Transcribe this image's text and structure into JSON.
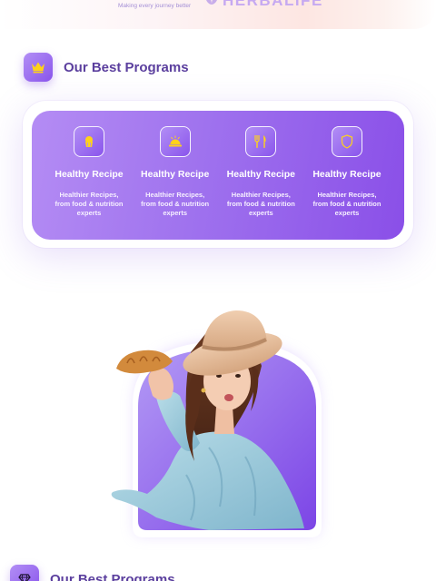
{
  "banner": {
    "tagline": "Making every journey better",
    "brand": "HERBALIFE"
  },
  "section": {
    "title": "Our Best Programs",
    "icon": "crown-icon"
  },
  "programs": [
    {
      "title": "Healthy Recipe",
      "description": "Healthier Recipes, from food & nutrition experts",
      "icon": "cupcake-icon"
    },
    {
      "title": "Healthy Recipe",
      "description": "Healthier Recipes, from food & nutrition experts",
      "icon": "food-cloche-icon"
    },
    {
      "title": "Healthy Recipe",
      "description": "Healthier Recipes, from food & nutrition experts",
      "icon": "fork-knife-icon"
    },
    {
      "title": "Healthy Recipe",
      "description": "Healthier Recipes, from food & nutrition experts",
      "icon": "shield-icon"
    }
  ],
  "section2": {
    "title": "Our Best Programs",
    "icon": "diamond-icon"
  },
  "colors": {
    "accent": "#8a55ec",
    "title": "#5b3f9e",
    "icon_yellow": "#ffd21a"
  }
}
